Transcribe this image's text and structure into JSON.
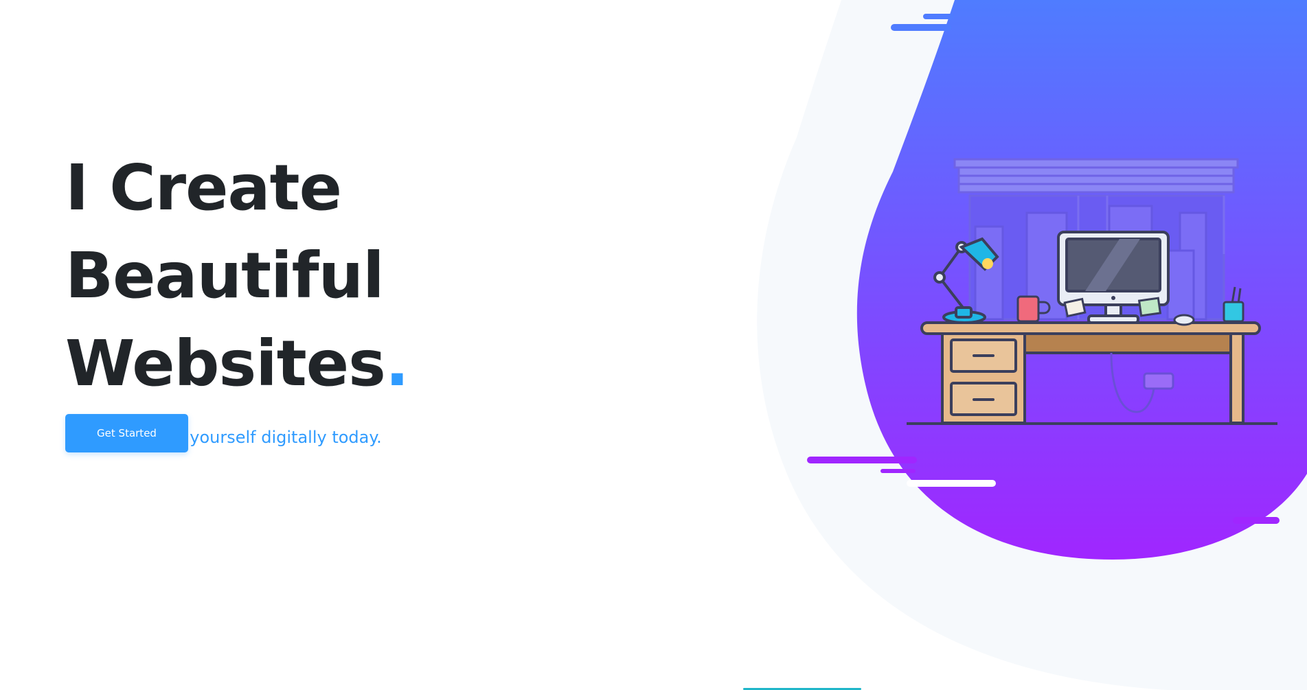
{
  "hero": {
    "title_line1": "I Create Beautiful",
    "title_line2": "Websites",
    "title_dot": ".",
    "subtitle": "Start branding yourself digitally today.",
    "cta_label": "Get Started"
  },
  "colors": {
    "accent": "#2f9bff",
    "heading": "#212529",
    "blob_top": "#4f7cff",
    "blob_bottom": "#a026ff",
    "background_blob": "#f6f9fc"
  }
}
